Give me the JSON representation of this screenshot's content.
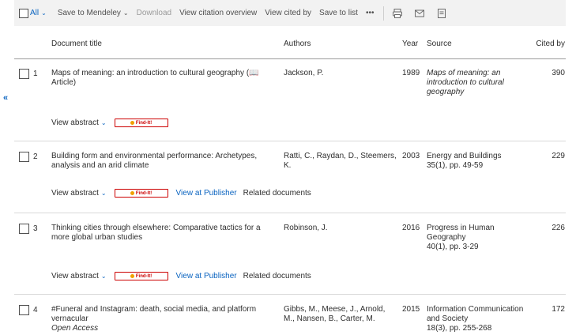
{
  "toolbar": {
    "all_label": "All",
    "save_mendeley": "Save to Mendeley",
    "download": "Download",
    "view_citation_overview": "View citation overview",
    "view_cited_by": "View cited by",
    "save_to_list": "Save to list",
    "more": "•••",
    "icons": [
      "print-icon",
      "email-icon",
      "export-icon"
    ]
  },
  "columns": {
    "title": "Document title",
    "authors": "Authors",
    "year": "Year",
    "source": "Source",
    "cited_by": "Cited by"
  },
  "rows": [
    {
      "num": "1",
      "title": "Maps of meaning: an introduction to cultural geography (📖 Article)",
      "oa": "",
      "authors": "Jackson, P.",
      "year": "1989",
      "source": "Maps of meaning: an introduction to cultural geography",
      "source_detail": "",
      "cited_by": "390",
      "view_abstract": "View abstract",
      "find_it": "Find-It!",
      "view_at_publisher": "",
      "related_documents": ""
    },
    {
      "num": "2",
      "title": "Building form and environmental performance: Archetypes, analysis and an arid climate",
      "oa": "",
      "authors": "Ratti, C., Raydan, D., Steemers, K.",
      "year": "2003",
      "source": "Energy and Buildings",
      "source_detail": "35(1), pp. 49-59",
      "cited_by": "229",
      "view_abstract": "View abstract",
      "find_it": "Find-It!",
      "view_at_publisher": "View at Publisher",
      "related_documents": "Related documents"
    },
    {
      "num": "3",
      "title": "Thinking cities through elsewhere: Comparative tactics for a more global urban studies",
      "oa": "",
      "authors": "Robinson, J.",
      "year": "2016",
      "source": "Progress in Human Geography",
      "source_detail": "40(1), pp. 3-29",
      "cited_by": "226",
      "view_abstract": "View abstract",
      "find_it": "Find-It!",
      "view_at_publisher": "View at Publisher",
      "related_documents": "Related documents"
    },
    {
      "num": "4",
      "title": "#Funeral and Instagram: death, social media, and platform vernacular",
      "oa": "Open Access",
      "authors": "Gibbs, M., Meese, J., Arnold, M., Nansen, B., Carter, M.",
      "year": "2015",
      "source": "Information Communication and Society",
      "source_detail": "18(3), pp. 255-268",
      "cited_by": "172"
    }
  ],
  "colors": {
    "accent": "#0b64c0",
    "toolbar_bg": "#f2f2f2",
    "findit_red": "#cc0000"
  }
}
